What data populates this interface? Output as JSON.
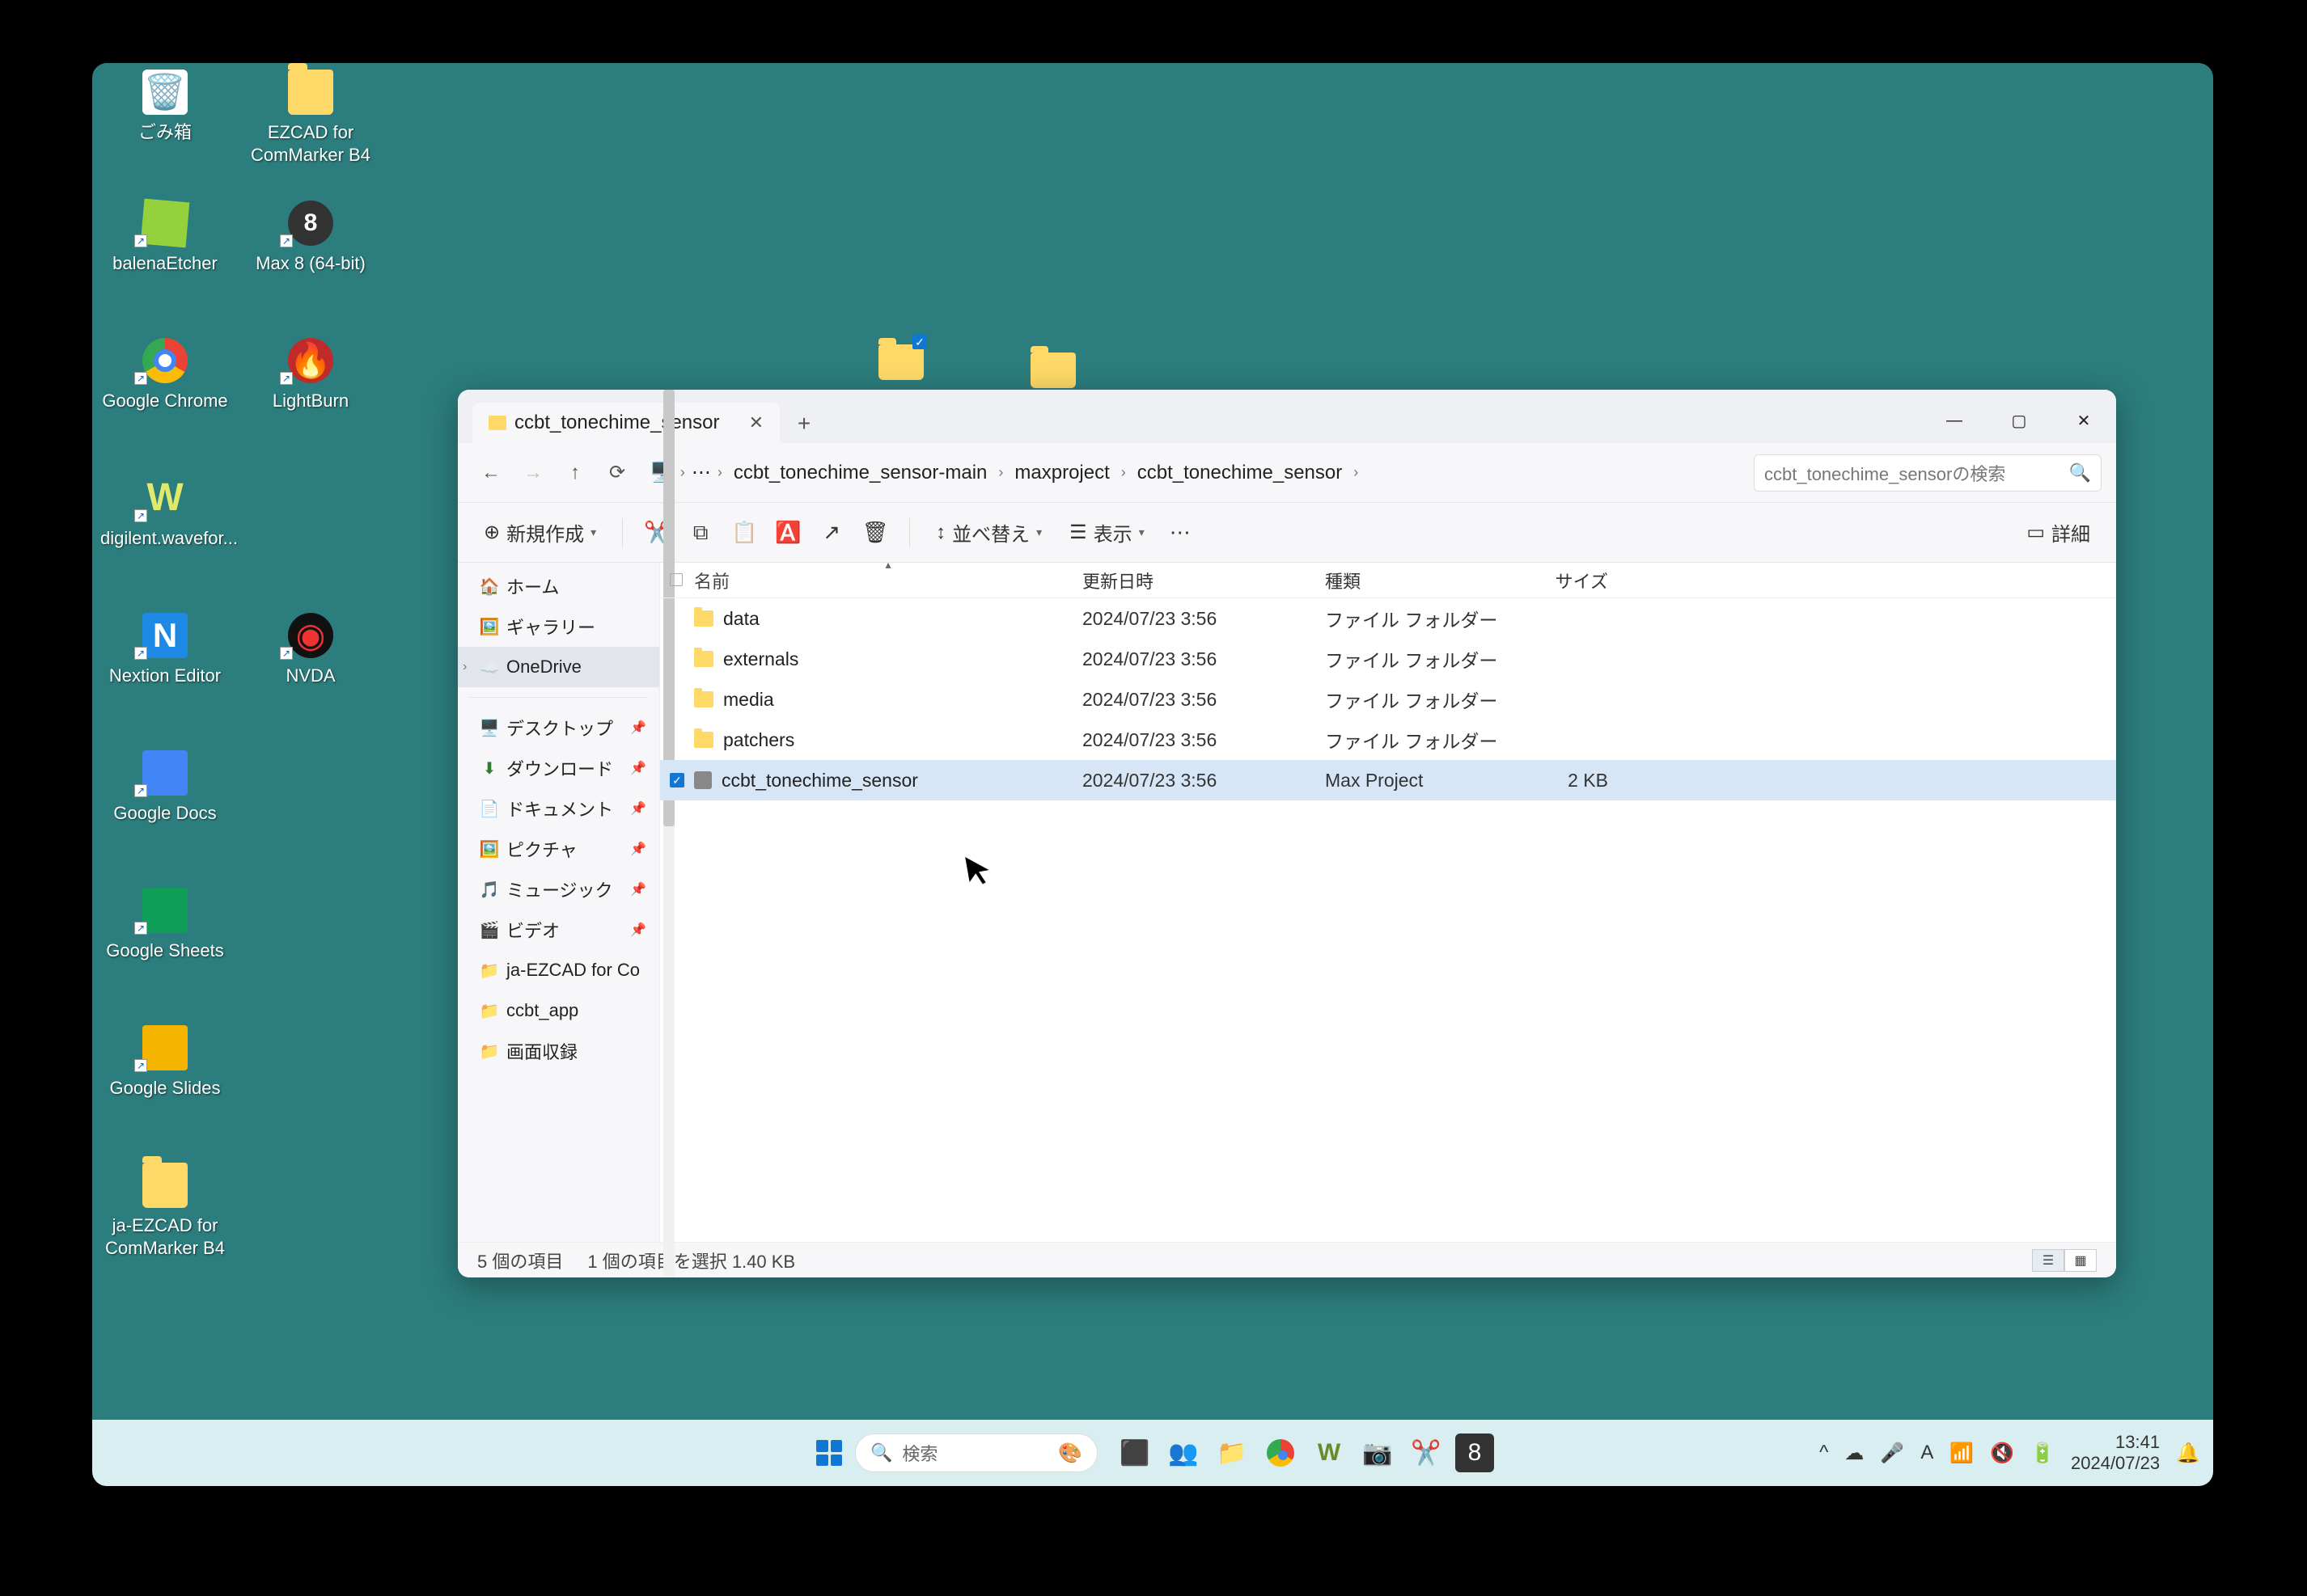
{
  "desktop_icons": [
    {
      "label": "ごみ箱",
      "type": "recycle",
      "shortcut": false
    },
    {
      "label": "EZCAD for ComMarker B4",
      "type": "folder",
      "shortcut": false
    },
    {
      "label": "balenaEtcher",
      "type": "cube",
      "shortcut": true
    },
    {
      "label": "Max 8 (64-bit)",
      "type": "max8",
      "shortcut": true
    },
    {
      "label": "Google Chrome",
      "type": "chrome",
      "shortcut": true
    },
    {
      "label": "LightBurn",
      "type": "lightburn",
      "shortcut": true
    },
    {
      "label": "digilent.wavefor...",
      "type": "wave",
      "shortcut": true
    },
    {
      "label": "Nextion Editor",
      "type": "nextion",
      "shortcut": true
    },
    {
      "label": "NVDA",
      "type": "nvda",
      "shortcut": true
    },
    {
      "label": "Google Docs",
      "type": "docs",
      "shortcut": true
    },
    {
      "label": "Google Sheets",
      "type": "sheets",
      "shortcut": true
    },
    {
      "label": "Google Slides",
      "type": "slides",
      "shortcut": true
    },
    {
      "label": "ja-EZCAD for ComMarker B4",
      "type": "folder",
      "shortcut": false
    }
  ],
  "explorer": {
    "tab_title": "ccbt_tonechime_sensor",
    "breadcrumbs": [
      "ccbt_tonechime_sensor-main",
      "maxproject",
      "ccbt_tonechime_sensor"
    ],
    "search_placeholder": "ccbt_tonechime_sensorの検索",
    "toolbar": {
      "new": "新規作成",
      "sort": "並べ替え",
      "view": "表示",
      "details": "詳細"
    },
    "nav": {
      "home": "ホーム",
      "gallery": "ギャラリー",
      "onedrive": "OneDrive",
      "desktop": "デスクトップ",
      "downloads": "ダウンロード",
      "documents": "ドキュメント",
      "pictures": "ピクチャ",
      "music": "ミュージック",
      "videos": "ビデオ",
      "ezcad": "ja-EZCAD for Co",
      "ccbt": "ccbt_app",
      "screen": "画面収録"
    },
    "columns": {
      "name": "名前",
      "date": "更新日時",
      "type": "種類",
      "size": "サイズ"
    },
    "folder_type": "ファイル フォルダー",
    "rows": [
      {
        "name": "data",
        "date": "2024/07/23 3:56",
        "type": "ファイル フォルダー",
        "size": "",
        "kind": "folder",
        "selected": false
      },
      {
        "name": "externals",
        "date": "2024/07/23 3:56",
        "type": "ファイル フォルダー",
        "size": "",
        "kind": "folder",
        "selected": false
      },
      {
        "name": "media",
        "date": "2024/07/23 3:56",
        "type": "ファイル フォルダー",
        "size": "",
        "kind": "folder",
        "selected": false
      },
      {
        "name": "patchers",
        "date": "2024/07/23 3:56",
        "type": "ファイル フォルダー",
        "size": "",
        "kind": "folder",
        "selected": false
      },
      {
        "name": "ccbt_tonechime_sensor",
        "date": "2024/07/23 3:56",
        "type": "Max Project",
        "size": "2 KB",
        "kind": "file",
        "selected": true
      }
    ],
    "status": {
      "count": "5 個の項目",
      "selected": "1 個の項目を選択 1.40 KB"
    }
  },
  "taskbar": {
    "search_placeholder": "検索",
    "clock_time": "13:41",
    "clock_date": "2024/07/23"
  }
}
